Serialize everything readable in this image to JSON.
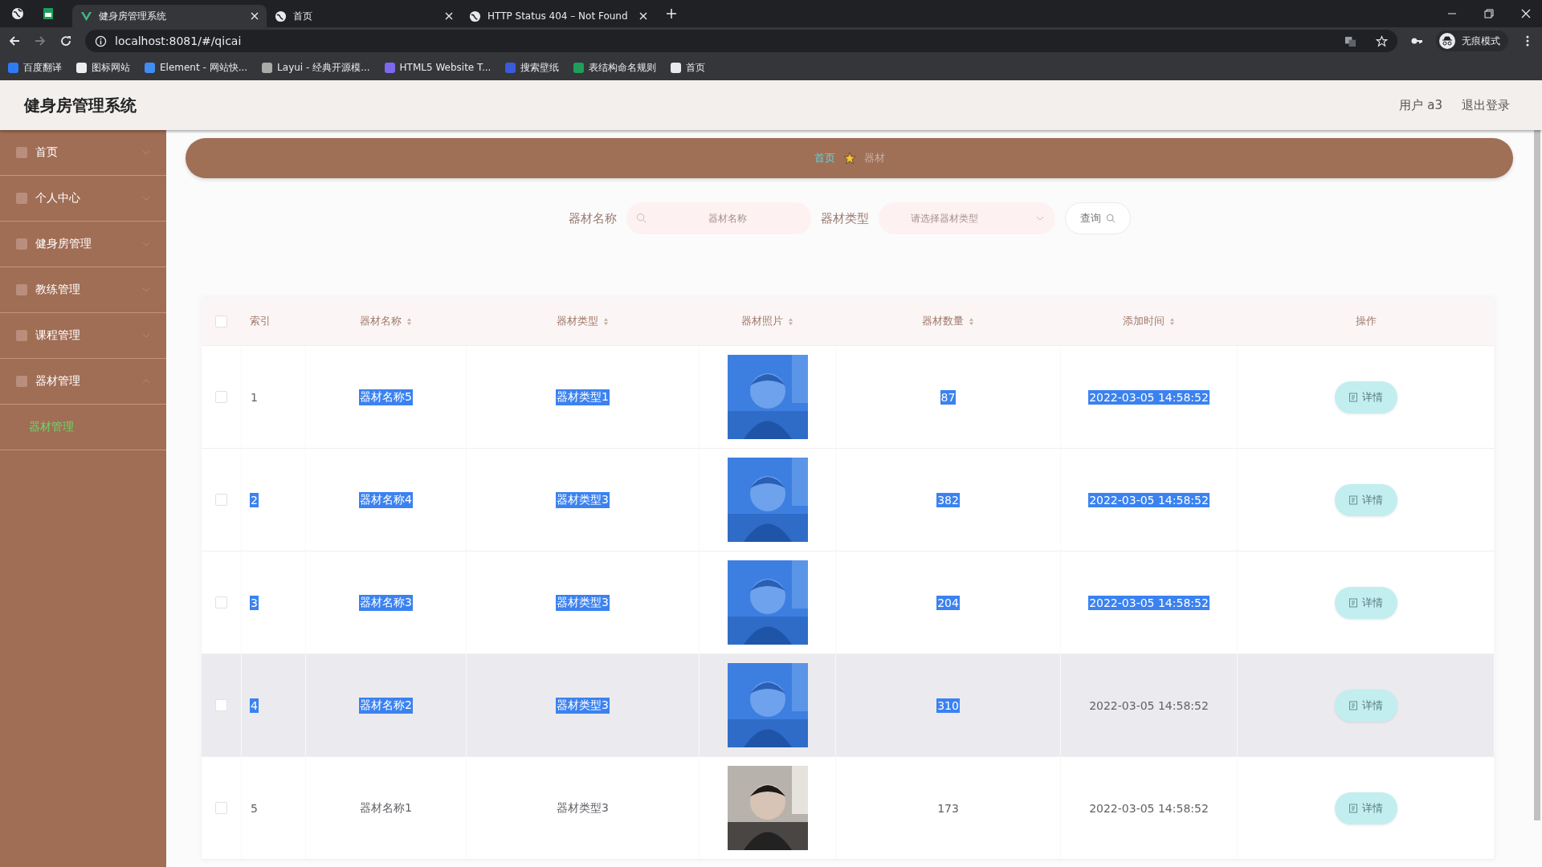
{
  "browser": {
    "tabs": [
      {
        "title": "健身房管理系统",
        "selected": true
      },
      {
        "title": "首页",
        "selected": false
      },
      {
        "title": "HTTP Status 404 – Not Found",
        "selected": false
      }
    ],
    "address": "localhost:8081/#/qicai",
    "profile": "无痕模式",
    "bookmarks": [
      "百度翻译",
      "图标网站",
      "Element - 网站快...",
      "Layui - 经典开源模...",
      "HTML5 Website T...",
      "搜索壁纸",
      "表结构命名规则",
      "首页"
    ]
  },
  "header": {
    "title": "健身房管理系统",
    "user": "用户 a3",
    "logout": "退出登录"
  },
  "sidebar": {
    "items": [
      {
        "label": "首页",
        "expanded": false
      },
      {
        "label": "个人中心",
        "expanded": false
      },
      {
        "label": "健身房管理",
        "expanded": false
      },
      {
        "label": "教练管理",
        "expanded": false
      },
      {
        "label": "课程管理",
        "expanded": false
      },
      {
        "label": "器材管理",
        "expanded": true,
        "children": [
          {
            "label": "器材管理",
            "selected": true
          }
        ]
      }
    ]
  },
  "breadcrumb": [
    "首页",
    "器材"
  ],
  "search": {
    "name_label": "器材名称",
    "name_placeholder": "器材名称",
    "type_label": "器材类型",
    "type_placeholder": "请选择器材类型",
    "button": "查询"
  },
  "table": {
    "all_checked": false,
    "columns": [
      "索引",
      "器材名称",
      "器材类型",
      "器材照片",
      "器材数量",
      "添加时间",
      "操作"
    ],
    "rows": [
      {
        "hovered": false,
        "index": {
          "text": "1",
          "highlighted": false
        },
        "name": {
          "text": "器材名称5",
          "highlighted": true
        },
        "type": {
          "text": "器材类型1",
          "highlighted": true
        },
        "photo": {
          "kind": "picture",
          "highlighted": true
        },
        "count": {
          "text": "87",
          "highlighted": true
        },
        "time": {
          "text": "2022-03-05 14:58:52",
          "highlighted": true
        },
        "action": "详情"
      },
      {
        "hovered": false,
        "index": {
          "text": "2",
          "highlighted": true
        },
        "name": {
          "text": "器材名称4",
          "highlighted": true
        },
        "type": {
          "text": "器材类型3",
          "highlighted": true
        },
        "photo": {
          "kind": "picture",
          "highlighted": true
        },
        "count": {
          "text": "382",
          "highlighted": true
        },
        "time": {
          "text": "2022-03-05 14:58:52",
          "highlighted": true
        },
        "action": "详情"
      },
      {
        "hovered": false,
        "index": {
          "text": "3",
          "highlighted": true
        },
        "name": {
          "text": "器材名称3",
          "highlighted": true
        },
        "type": {
          "text": "器材类型3",
          "highlighted": true
        },
        "photo": {
          "kind": "picture",
          "highlighted": true
        },
        "count": {
          "text": "204",
          "highlighted": true
        },
        "time": {
          "text": "2022-03-05 14:58:52",
          "highlighted": true
        },
        "action": "详情"
      },
      {
        "hovered": true,
        "index": {
          "text": "4",
          "highlighted": true
        },
        "name": {
          "text": "器材名称2",
          "highlighted": true
        },
        "type": {
          "text": "器材类型3",
          "highlighted": true
        },
        "photo": {
          "kind": "picture",
          "highlighted": true
        },
        "count": {
          "text": "310",
          "highlighted": true
        },
        "time": {
          "text": "2022-03-05 14:58:52",
          "highlighted": false
        },
        "action": "详情"
      },
      {
        "hovered": false,
        "index": {
          "text": "5",
          "highlighted": false
        },
        "name": {
          "text": "器材名称1",
          "highlighted": false
        },
        "type": {
          "text": "器材类型3",
          "highlighted": false
        },
        "photo": {
          "kind": "picture",
          "highlighted": false
        },
        "count": {
          "text": "173",
          "highlighted": false
        },
        "time": {
          "text": "2022-03-05 14:58:52",
          "highlighted": false
        },
        "action": "详情"
      }
    ]
  }
}
